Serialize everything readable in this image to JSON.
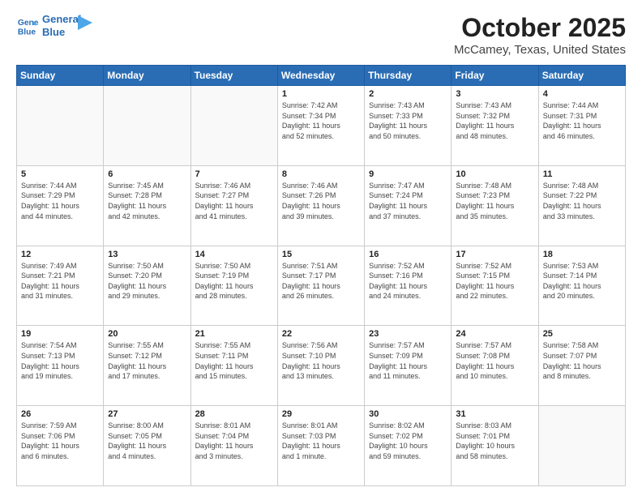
{
  "header": {
    "logo_line1": "General",
    "logo_line2": "Blue",
    "title": "October 2025",
    "subtitle": "McCamey, Texas, United States"
  },
  "days_of_week": [
    "Sunday",
    "Monday",
    "Tuesday",
    "Wednesday",
    "Thursday",
    "Friday",
    "Saturday"
  ],
  "weeks": [
    [
      {
        "day": "",
        "info": ""
      },
      {
        "day": "",
        "info": ""
      },
      {
        "day": "",
        "info": ""
      },
      {
        "day": "1",
        "info": "Sunrise: 7:42 AM\nSunset: 7:34 PM\nDaylight: 11 hours\nand 52 minutes."
      },
      {
        "day": "2",
        "info": "Sunrise: 7:43 AM\nSunset: 7:33 PM\nDaylight: 11 hours\nand 50 minutes."
      },
      {
        "day": "3",
        "info": "Sunrise: 7:43 AM\nSunset: 7:32 PM\nDaylight: 11 hours\nand 48 minutes."
      },
      {
        "day": "4",
        "info": "Sunrise: 7:44 AM\nSunset: 7:31 PM\nDaylight: 11 hours\nand 46 minutes."
      }
    ],
    [
      {
        "day": "5",
        "info": "Sunrise: 7:44 AM\nSunset: 7:29 PM\nDaylight: 11 hours\nand 44 minutes."
      },
      {
        "day": "6",
        "info": "Sunrise: 7:45 AM\nSunset: 7:28 PM\nDaylight: 11 hours\nand 42 minutes."
      },
      {
        "day": "7",
        "info": "Sunrise: 7:46 AM\nSunset: 7:27 PM\nDaylight: 11 hours\nand 41 minutes."
      },
      {
        "day": "8",
        "info": "Sunrise: 7:46 AM\nSunset: 7:26 PM\nDaylight: 11 hours\nand 39 minutes."
      },
      {
        "day": "9",
        "info": "Sunrise: 7:47 AM\nSunset: 7:24 PM\nDaylight: 11 hours\nand 37 minutes."
      },
      {
        "day": "10",
        "info": "Sunrise: 7:48 AM\nSunset: 7:23 PM\nDaylight: 11 hours\nand 35 minutes."
      },
      {
        "day": "11",
        "info": "Sunrise: 7:48 AM\nSunset: 7:22 PM\nDaylight: 11 hours\nand 33 minutes."
      }
    ],
    [
      {
        "day": "12",
        "info": "Sunrise: 7:49 AM\nSunset: 7:21 PM\nDaylight: 11 hours\nand 31 minutes."
      },
      {
        "day": "13",
        "info": "Sunrise: 7:50 AM\nSunset: 7:20 PM\nDaylight: 11 hours\nand 29 minutes."
      },
      {
        "day": "14",
        "info": "Sunrise: 7:50 AM\nSunset: 7:19 PM\nDaylight: 11 hours\nand 28 minutes."
      },
      {
        "day": "15",
        "info": "Sunrise: 7:51 AM\nSunset: 7:17 PM\nDaylight: 11 hours\nand 26 minutes."
      },
      {
        "day": "16",
        "info": "Sunrise: 7:52 AM\nSunset: 7:16 PM\nDaylight: 11 hours\nand 24 minutes."
      },
      {
        "day": "17",
        "info": "Sunrise: 7:52 AM\nSunset: 7:15 PM\nDaylight: 11 hours\nand 22 minutes."
      },
      {
        "day": "18",
        "info": "Sunrise: 7:53 AM\nSunset: 7:14 PM\nDaylight: 11 hours\nand 20 minutes."
      }
    ],
    [
      {
        "day": "19",
        "info": "Sunrise: 7:54 AM\nSunset: 7:13 PM\nDaylight: 11 hours\nand 19 minutes."
      },
      {
        "day": "20",
        "info": "Sunrise: 7:55 AM\nSunset: 7:12 PM\nDaylight: 11 hours\nand 17 minutes."
      },
      {
        "day": "21",
        "info": "Sunrise: 7:55 AM\nSunset: 7:11 PM\nDaylight: 11 hours\nand 15 minutes."
      },
      {
        "day": "22",
        "info": "Sunrise: 7:56 AM\nSunset: 7:10 PM\nDaylight: 11 hours\nand 13 minutes."
      },
      {
        "day": "23",
        "info": "Sunrise: 7:57 AM\nSunset: 7:09 PM\nDaylight: 11 hours\nand 11 minutes."
      },
      {
        "day": "24",
        "info": "Sunrise: 7:57 AM\nSunset: 7:08 PM\nDaylight: 11 hours\nand 10 minutes."
      },
      {
        "day": "25",
        "info": "Sunrise: 7:58 AM\nSunset: 7:07 PM\nDaylight: 11 hours\nand 8 minutes."
      }
    ],
    [
      {
        "day": "26",
        "info": "Sunrise: 7:59 AM\nSunset: 7:06 PM\nDaylight: 11 hours\nand 6 minutes."
      },
      {
        "day": "27",
        "info": "Sunrise: 8:00 AM\nSunset: 7:05 PM\nDaylight: 11 hours\nand 4 minutes."
      },
      {
        "day": "28",
        "info": "Sunrise: 8:01 AM\nSunset: 7:04 PM\nDaylight: 11 hours\nand 3 minutes."
      },
      {
        "day": "29",
        "info": "Sunrise: 8:01 AM\nSunset: 7:03 PM\nDaylight: 11 hours\nand 1 minute."
      },
      {
        "day": "30",
        "info": "Sunrise: 8:02 AM\nSunset: 7:02 PM\nDaylight: 10 hours\nand 59 minutes."
      },
      {
        "day": "31",
        "info": "Sunrise: 8:03 AM\nSunset: 7:01 PM\nDaylight: 10 hours\nand 58 minutes."
      },
      {
        "day": "",
        "info": ""
      }
    ]
  ]
}
